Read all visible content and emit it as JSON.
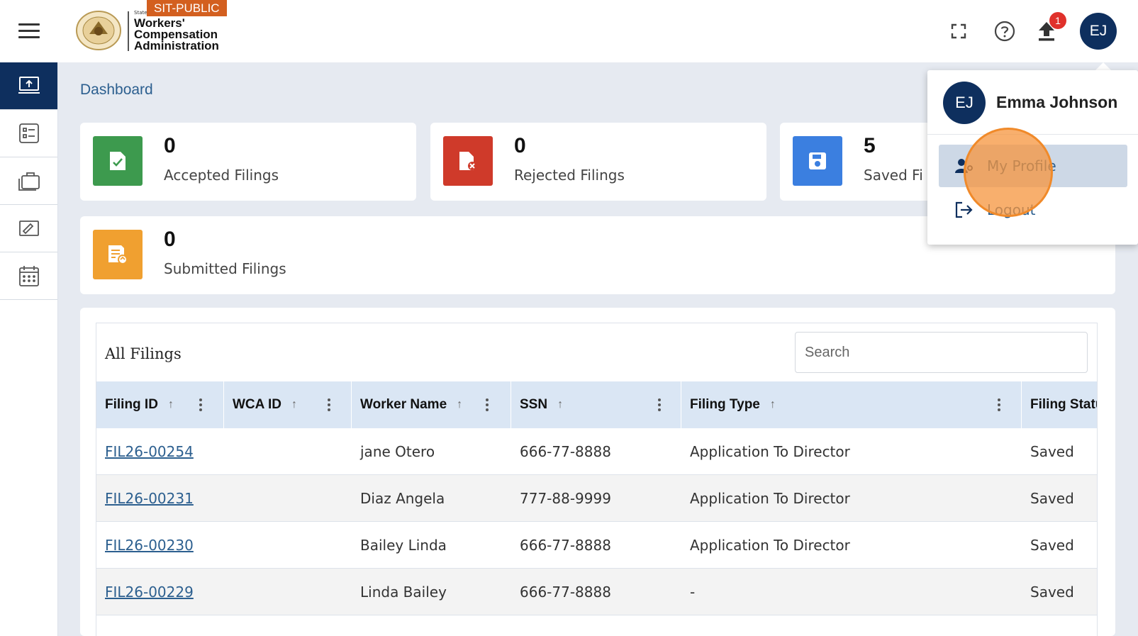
{
  "header": {
    "env_badge": "SIT-PUBLIC",
    "logo_small": "State",
    "logo_line1": "Workers'",
    "logo_line2": "Compensation",
    "logo_line3": "Administration",
    "notification_count": "1",
    "avatar_initials": "EJ",
    "icons": [
      "menu-icon",
      "fullscreen-icon",
      "help-icon",
      "upload-icon"
    ]
  },
  "sidebar": {
    "items": [
      {
        "icon": "upload-monitor-icon",
        "active": true
      },
      {
        "icon": "checklist-icon",
        "active": false
      },
      {
        "icon": "briefcase-icon",
        "active": false
      },
      {
        "icon": "form-edit-icon",
        "active": false
      },
      {
        "icon": "calendar-icon",
        "active": false
      }
    ]
  },
  "breadcrumb": "Dashboard",
  "stats": [
    {
      "value": "0",
      "label": "Accepted Filings",
      "color": "#3d9a4e",
      "icon": "file-check-icon"
    },
    {
      "value": "0",
      "label": "Rejected Filings",
      "color": "#cf3a2a",
      "icon": "file-reject-icon"
    },
    {
      "value": "5",
      "label": "Saved Fi",
      "color": "#3b7fe0",
      "icon": "save-icon"
    },
    {
      "value": "0",
      "label": "Submitted Filings",
      "color": "#f0a030",
      "icon": "file-submit-icon"
    }
  ],
  "table": {
    "title": "All Filings",
    "search_placeholder": "Search",
    "columns": [
      "Filing ID",
      "WCA ID",
      "Worker Name",
      "SSN",
      "Filing Type",
      "Filing Statu"
    ],
    "rows": [
      {
        "filing_id": "FIL26-00254",
        "wca_id": "",
        "worker": "jane Otero",
        "ssn": "666-77-8888",
        "type": "Application To Director",
        "status": "Saved"
      },
      {
        "filing_id": "FIL26-00231",
        "wca_id": "",
        "worker": "Diaz Angela",
        "ssn": "777-88-9999",
        "type": "Application To Director",
        "status": "Saved"
      },
      {
        "filing_id": "FIL26-00230",
        "wca_id": "",
        "worker": "Bailey Linda",
        "ssn": "666-77-8888",
        "type": "Application To Director",
        "status": "Saved"
      },
      {
        "filing_id": "FIL26-00229",
        "wca_id": "",
        "worker": "Linda Bailey",
        "ssn": "666-77-8888",
        "type": "-",
        "status": "Saved"
      }
    ]
  },
  "user_menu": {
    "initials": "EJ",
    "name": "Emma Johnson",
    "items": [
      {
        "label": "My Profile",
        "icon": "user-profile-icon"
      },
      {
        "label": "Logout",
        "icon": "logout-icon"
      }
    ]
  }
}
